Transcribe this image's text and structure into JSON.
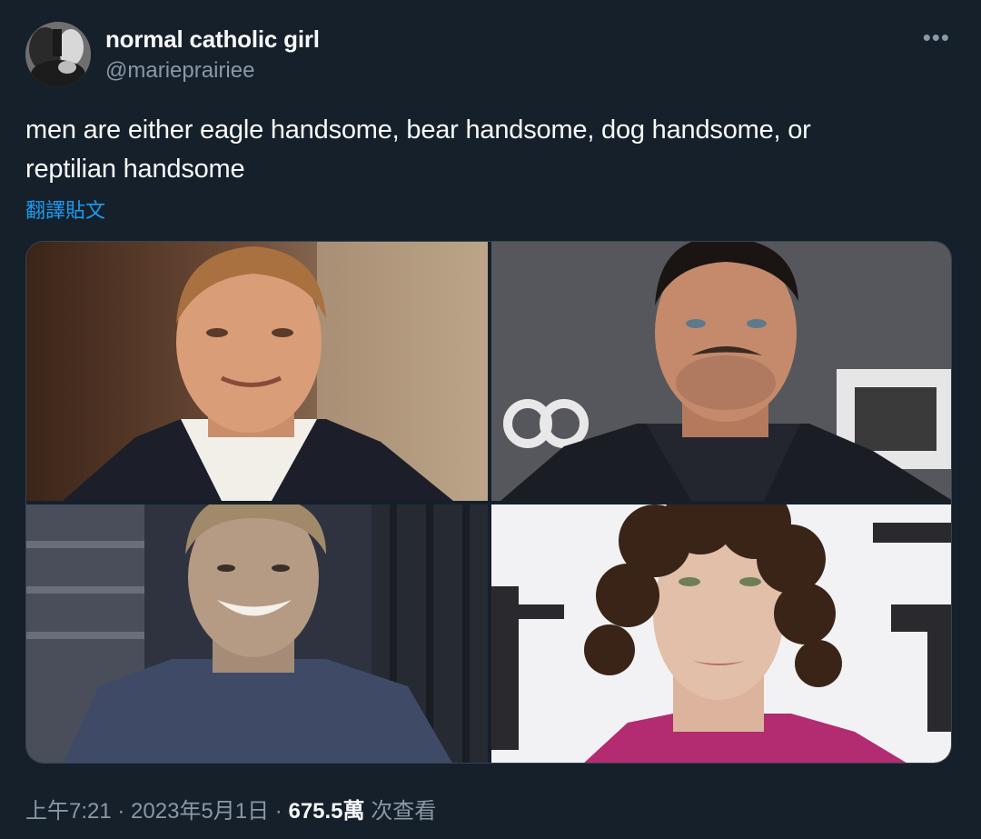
{
  "tweet": {
    "display_name": "normal catholic girl",
    "handle": "@marieprairiee",
    "more_icon": "•••",
    "text_line1": "men are either eagle handsome, bear handsome, dog handsome, or",
    "text_line2": "reptilian handsome",
    "translate_label": "翻譯貼文"
  },
  "media": {
    "photos": [
      {
        "subject": "man-photo-eagle"
      },
      {
        "subject": "man-photo-bear"
      },
      {
        "subject": "man-photo-dog"
      },
      {
        "subject": "man-photo-reptilian"
      }
    ]
  },
  "meta": {
    "time": "上午7:21",
    "separator1": " · ",
    "date": "2023年5月1日",
    "separator2": " · ",
    "views_count": "675.5萬",
    "views_label": " 次查看"
  },
  "colors": {
    "background": "#15202b",
    "text_primary": "#f7f9f9",
    "text_secondary": "#8b98a5",
    "link": "#1d9bf0",
    "border": "#38444d"
  }
}
